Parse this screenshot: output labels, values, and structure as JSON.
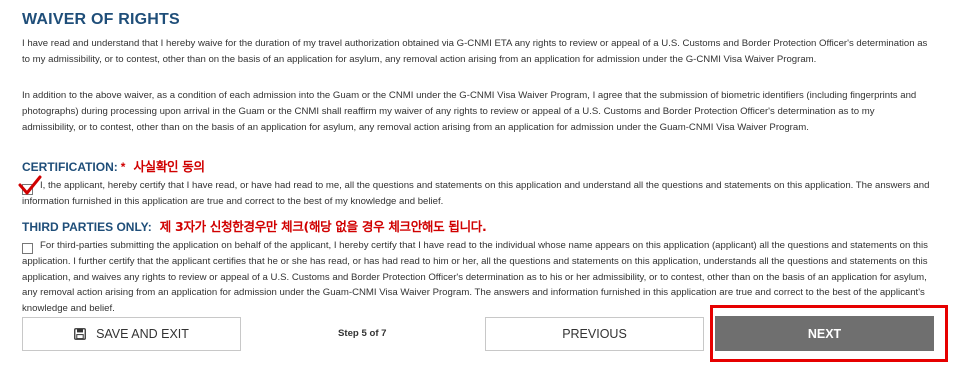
{
  "waiver": {
    "title": "WAIVER OF RIGHTS",
    "para1": "I have read and understand that I hereby waive for the duration of my travel authorization obtained via G-CNMI ETA any rights to review or appeal of a U.S. Customs and Border Protection Officer's determination as to my admissibility, or to contest, other than on the basis of an application for asylum, any removal action arising from an application for admission under the G-CNMI Visa Waiver Program.",
    "para2": "In addition to the above waiver, as a condition of each admission into the Guam or the CNMI under the G-CNMI Visa Waiver Program, I agree that the submission of biometric identifiers (including fingerprints and photographs) during processing upon arrival in the Guam or the CNMI shall reaffirm my waiver of any rights to review or appeal of a U.S. Customs and Border Protection Officer's determination as to my admissibility, or to contest, other than on the basis of an application for asylum, any removal action arising from an application for admission under the Guam-CNMI Visa Waiver Program."
  },
  "certification": {
    "heading": "CERTIFICATION:",
    "required_marker": "*",
    "annotation": "사실확인 동의",
    "text": "I, the applicant, hereby certify that I have read, or have had read to me, all the questions and statements on this application and understand all the questions and statements on this application. The answers and information furnished in this application are true and correct to the best of my knowledge and belief.",
    "checked": true
  },
  "third_parties": {
    "heading": "THIRD PARTIES ONLY:",
    "annotation": "제 3자가 신청한경우만 체크(해당 없을 경우 체크안해도 됩니다.",
    "text": "For third-parties submitting the application on behalf of the applicant, I hereby certify that I have read to the individual whose name appears on this application (applicant) all the questions and statements on this application. I further certify that the applicant certifies that he or she has read, or has had read to him or her, all the questions and statements on this application, understands all the questions and statements on this application, and waives any rights to review or appeal of a U.S. Customs and Border Protection Officer's determination as to his or her admissibility, or to contest, other than on the basis of an application for asylum, any removal action arising from an application for admission under the Guam-CNMI Visa Waiver Program. The answers and information furnished in this application are true and correct to the best of the applicant's knowledge and belief.",
    "checked": false
  },
  "footer": {
    "save_exit_label": "SAVE AND EXIT",
    "save_icon": "floppy-disk-icon",
    "step_label": "Step 5 of 7",
    "previous_label": "PREVIOUS",
    "next_label": "NEXT"
  },
  "colors": {
    "heading": "#1f4e79",
    "annotation": "#d00000",
    "next_button": "#6f6f6f",
    "highlight": "#e60000"
  }
}
